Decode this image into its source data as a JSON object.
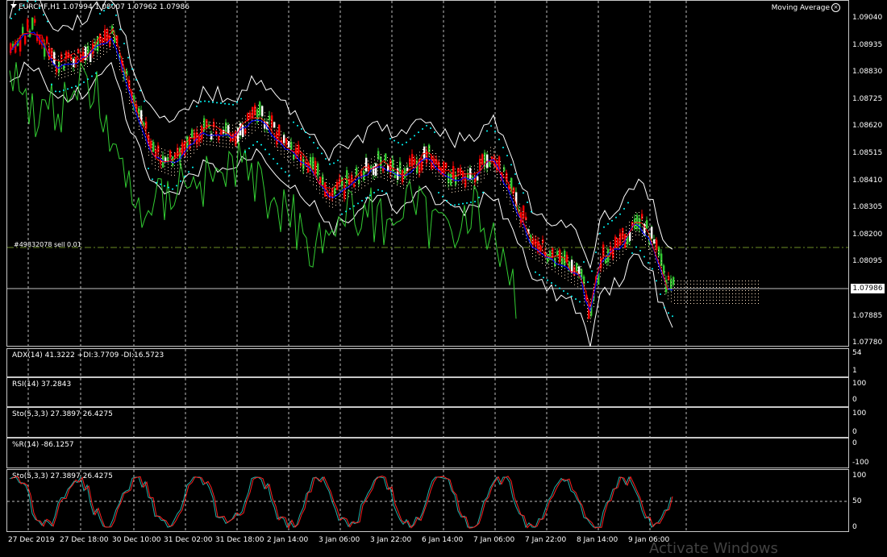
{
  "chart_header": {
    "symbol_title": "EURCHF,H1  1.07994 1.08007 1.07962 1.07986",
    "indicator_label": "Moving Average"
  },
  "order_line_label": "#49832078 sell 0.01",
  "current_price": "1.07986",
  "price_scale": [
    "1.09040",
    "1.08935",
    "1.08830",
    "1.08725",
    "1.08620",
    "1.08515",
    "1.08410",
    "1.08305",
    "1.08200",
    "1.08095",
    "1.07885",
    "1.07780"
  ],
  "indicators": [
    {
      "label": "ADX(14) 41.3222 +DI:3.7709 -DI:16.5723",
      "scale": [
        "54",
        "1"
      ]
    },
    {
      "label": "RSI(14) 37.2843",
      "scale": [
        "100",
        "0"
      ]
    },
    {
      "label": "Sto(5,3,3) 27.3897 26.4275",
      "scale": [
        "100",
        "0"
      ]
    },
    {
      "label": "%R(14) -86.1257",
      "scale": [
        "0",
        "-100"
      ]
    },
    {
      "label": "Sto(5,3,3) 27.3897 26.4275",
      "scale": [
        "100",
        "50",
        "0"
      ]
    }
  ],
  "time_axis": [
    "27 Dec 2019",
    "27 Dec 18:00",
    "30 Dec 10:00",
    "31 Dec 02:00",
    "31 Dec 18:00",
    "2 Jan 14:00",
    "3 Jan 06:00",
    "3 Jan 22:00",
    "6 Jan 14:00",
    "7 Jan 06:00",
    "7 Jan 22:00",
    "8 Jan 14:00",
    "9 Jan 06:00"
  ],
  "watermark": "Activate Windows",
  "colors": {
    "bull": "#32cd32",
    "bear": "#ff0000",
    "grid": "#c8c8c8",
    "bollinger": "#ffffff",
    "ma_blue": "#0000ff",
    "psar": "#00ffff",
    "rsi_line": "#32cd32",
    "sto_main": "#20b2aa",
    "sto_signal": "#ff2020"
  }
}
